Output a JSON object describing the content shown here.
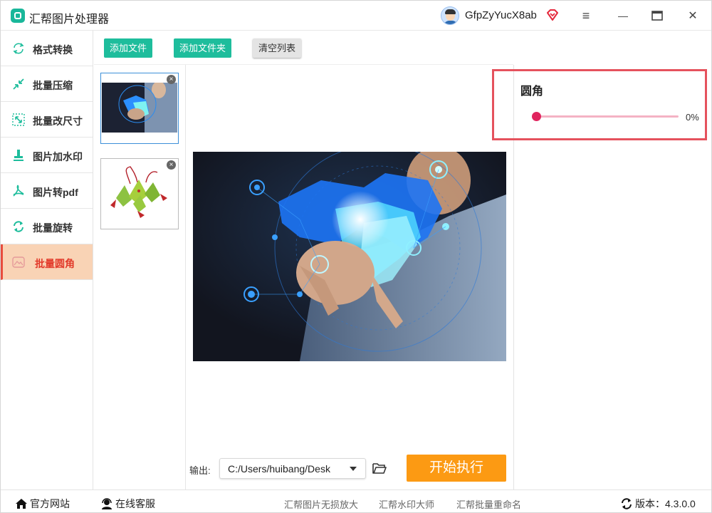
{
  "window": {
    "title": "汇帮图片处理器",
    "username": "GfpZyYucX8ab",
    "menu_icon": "≡",
    "minimize_icon": "—",
    "maximize_icon": "▭",
    "close_icon": "✕"
  },
  "sidebar": {
    "items": [
      {
        "label": "格式转换",
        "icon": "format-convert-icon"
      },
      {
        "label": "批量压缩",
        "icon": "compress-icon"
      },
      {
        "label": "批量改尺寸",
        "icon": "resize-icon"
      },
      {
        "label": "图片加水印",
        "icon": "watermark-icon"
      },
      {
        "label": "图片转pdf",
        "icon": "pdf-icon"
      },
      {
        "label": "批量旋转",
        "icon": "rotate-icon"
      },
      {
        "label": "批量圆角",
        "icon": "rounded-corner-icon",
        "active": true
      }
    ]
  },
  "toolbar": {
    "add_file": "添加文件",
    "add_folder": "添加文件夹",
    "clear_list": "清空列表"
  },
  "settings": {
    "radius_title": "圆角",
    "radius_value": "0%",
    "radius_fraction": 0
  },
  "output": {
    "label": "输出:",
    "path": "C:/Users/huibang/Desk",
    "start_button": "开始执行"
  },
  "footer": {
    "website": "官方网站",
    "support": "在线客服",
    "link1": "汇帮图片无损放大",
    "link2": "汇帮水印大师",
    "link3": "汇帮批量重命名",
    "version_label": "版本：",
    "version": "4.3.0.0"
  },
  "colors": {
    "accent_green": "#1ebd9c",
    "active_bg": "#f9d3b5",
    "active_text": "#e23a2a",
    "start_orange": "#fc9a13",
    "highlight_red": "#e5525d",
    "slider_pink": "#e0245e"
  }
}
